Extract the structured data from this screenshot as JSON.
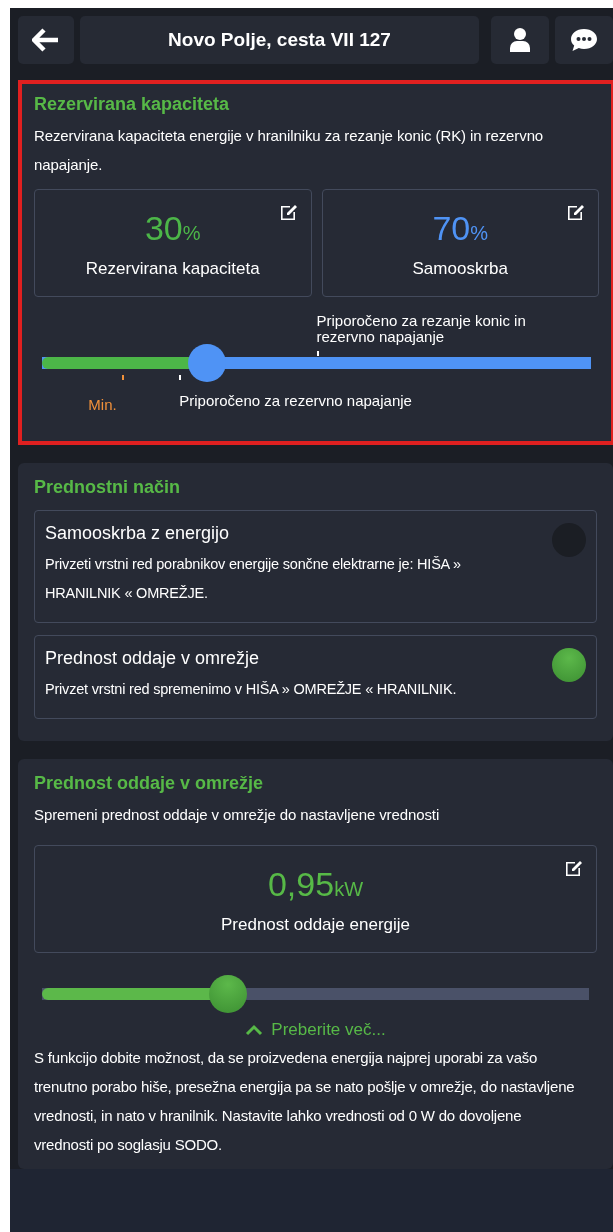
{
  "header": {
    "title": "Novo Polje, cesta VII 127"
  },
  "reserve": {
    "title": "Rezervirana kapaciteta",
    "highlighted": true,
    "description": "Rezervirana kapaciteta energije v hranilniku za rezanje konic (RK) in rezervno napajanje.",
    "tiles": [
      {
        "value": "30",
        "unit": "%",
        "label": "Rezervirana kapaciteta",
        "color": "#4cb648"
      },
      {
        "value": "70",
        "unit": "%",
        "label": "Samooskrba",
        "color": "#4f93f5"
      }
    ],
    "slider": {
      "level": 0.3,
      "markers": [
        {
          "kind": "min",
          "label": "Min."
        },
        {
          "kind": "below",
          "label": "Priporočeno za rezervno napajanje"
        },
        {
          "kind": "above",
          "label": "Priporočeno za rezanje konic in rezervno napajanje"
        }
      ]
    }
  },
  "priority_mode": {
    "title": "Prednostni način",
    "options": [
      {
        "title": "Samooskrba z energijo",
        "description": "Privzeti vrstni red porabnikov energije sončne elektrarne je: HIŠA » HRANILNIK « OMREŽJE.",
        "selected": false
      },
      {
        "title": "Prednost oddaje v omrežje",
        "description": "Privzet vrstni red spremenimo v HIŠA » OMREŽJE « HRANILNIK.",
        "selected": true
      }
    ]
  },
  "export_priority": {
    "title": "Prednost oddaje v omrežje",
    "description": "Spremeni prednost oddaje v omrežje do nastavljene vrednosti",
    "tile": {
      "value": "0,95",
      "unit": "kW",
      "label": "Prednost oddaje energije"
    },
    "slider": {
      "level": 0.34
    },
    "read_more": {
      "label": "Preberite več...",
      "expanded": true
    },
    "details": "S funkcijo dobite možnost, da se proizvedena energija najprej uporabi za vašo trenutno porabo hiše, presežna energija pa se nato pošlje v omrežje, do nastavljene vrednosti, in nato v hranilnik. Nastavite lahko vrednosti od 0 W do dovoljene vrednosti po soglasju SODO."
  }
}
